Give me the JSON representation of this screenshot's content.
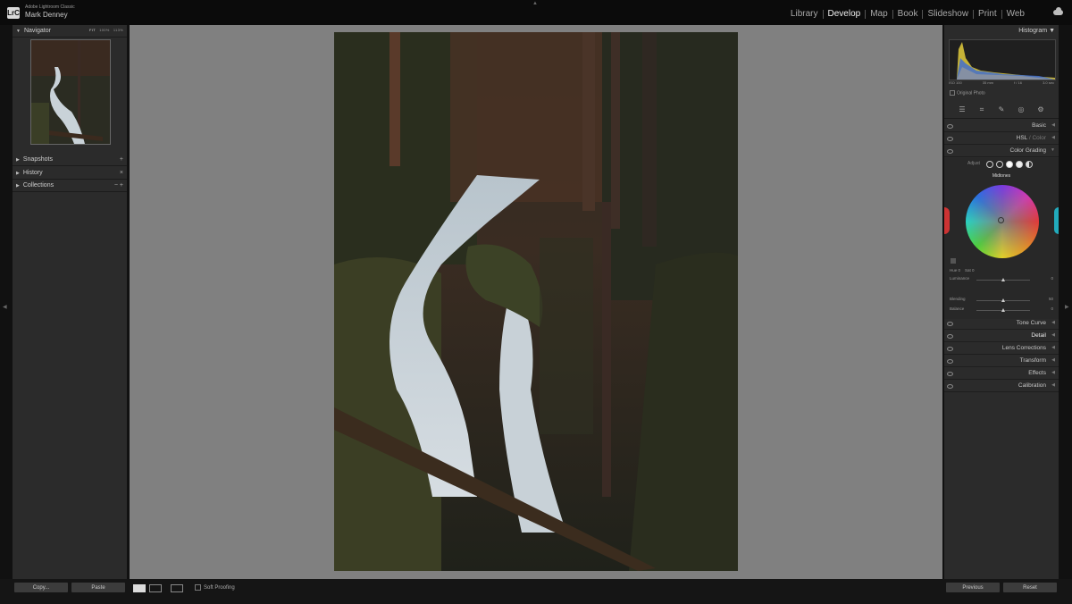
{
  "app": {
    "logo": "LrC",
    "name": "Adobe Lightroom Classic",
    "user": "Mark Denney"
  },
  "modules": [
    "Library",
    "Develop",
    "Map",
    "Book",
    "Slideshow",
    "Print",
    "Web"
  ],
  "active_module": "Develop",
  "left_panel": {
    "navigator": {
      "title": "Navigator",
      "zoom_fit": "FIT",
      "zoom_options": [
        "100%",
        "113%"
      ]
    },
    "snapshots": "Snapshots",
    "history": "History",
    "collections": "Collections"
  },
  "right_panel": {
    "histogram": {
      "title": "Histogram",
      "info": [
        "ISO 100",
        "35 mm",
        "f / 16",
        "3.0 sec"
      ],
      "original_photo": "Original Photo"
    },
    "sections": {
      "basic": "Basic",
      "hsl": "HSL",
      "hsl_sep": " / ",
      "color": "Color",
      "color_grading": "Color Grading",
      "tone_curve": "Tone Curve",
      "detail": "Detail",
      "lens_corrections": "Lens Corrections",
      "transform": "Transform",
      "effects": "Effects",
      "calibration": "Calibration"
    },
    "color_grading": {
      "adjust": "Adjust",
      "mode": "Midtones",
      "hue": "Hue  0",
      "sat": "Sat  0",
      "luminance": "Luminance",
      "luminance_value": "0",
      "blending": "Blending",
      "blending_value": "50",
      "balance": "Balance",
      "balance_value": "0"
    }
  },
  "bottom": {
    "copy": "Copy...",
    "paste": "Paste",
    "soft_proofing": "Soft Proofing",
    "previous": "Previous",
    "reset": "Reset"
  },
  "colors": {
    "panel_bg": "#2b2b2b",
    "canvas_bg": "#808080",
    "topbar_bg": "#0b0b0b"
  }
}
